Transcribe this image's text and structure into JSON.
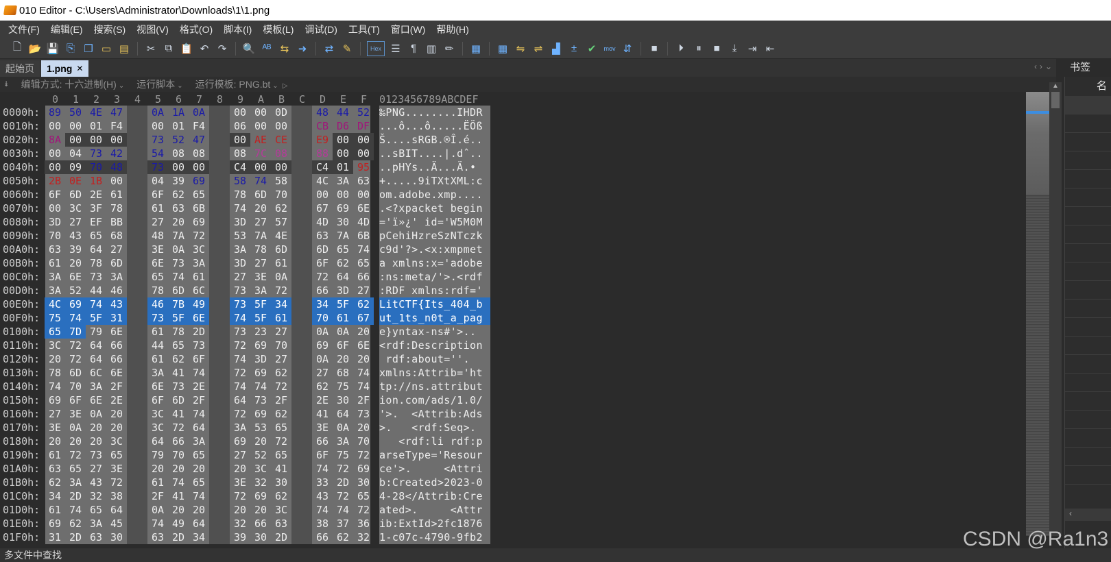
{
  "window": {
    "title": "010 Editor - C:\\Users\\Administrator\\Downloads\\1\\1.png"
  },
  "menu": [
    "文件(F)",
    "编辑(E)",
    "搜索(S)",
    "视图(V)",
    "格式(O)",
    "脚本(I)",
    "模板(L)",
    "调试(D)",
    "工具(T)",
    "窗口(W)",
    "帮助(H)"
  ],
  "tabs": [
    {
      "label": "起始页",
      "active": false
    },
    {
      "label": "1.png",
      "active": true
    }
  ],
  "bookmarks": {
    "title": "书签",
    "column_header": "名"
  },
  "editbar": {
    "edit_mode": "编辑方式: 十六进制(H)",
    "run_script": "运行脚本",
    "run_template": "运行模板: PNG.bt"
  },
  "hex": {
    "col_headers": [
      "0",
      "1",
      "2",
      "3",
      "4",
      "5",
      "6",
      "7",
      "8",
      "9",
      "A",
      "B",
      "C",
      "D",
      "E",
      "F"
    ],
    "ascii_header": "0123456789ABCDEF",
    "rows": [
      {
        "addr": "0000h:",
        "bytes": [
          "89",
          "50",
          "4E",
          "47",
          "0D",
          "0A",
          "1A",
          "0A",
          "00",
          "00",
          "00",
          "0D",
          "49",
          "48",
          "44",
          "52"
        ],
        "ascii": "‰PNG........IHDR"
      },
      {
        "addr": "0010h:",
        "bytes": [
          "00",
          "00",
          "01",
          "F4",
          "00",
          "00",
          "01",
          "F4",
          "08",
          "06",
          "00",
          "00",
          "00",
          "CB",
          "D6",
          "DF"
        ],
        "ascii": "...ô...ô.....ËÖß"
      },
      {
        "addr": "0020h:",
        "bytes": [
          "8A",
          "00",
          "00",
          "00",
          "01",
          "73",
          "52",
          "47",
          "42",
          "00",
          "AE",
          "CE",
          "1C",
          "E9",
          "00",
          "00"
        ],
        "ascii": "Š....sRGB.®Î.é.."
      },
      {
        "addr": "0030h:",
        "bytes": [
          "00",
          "04",
          "73",
          "42",
          "49",
          "54",
          "08",
          "08",
          "08",
          "08",
          "7C",
          "08",
          "64",
          "88",
          "00",
          "00"
        ],
        "ascii": "..sBIT....|.dˆ.."
      },
      {
        "addr": "0040h:",
        "bytes": [
          "00",
          "09",
          "70",
          "48",
          "59",
          "73",
          "00",
          "00",
          "0E",
          "C4",
          "00",
          "00",
          "0E",
          "C4",
          "01",
          "95"
        ],
        "ascii": "..pHYs..Ä...Ä.•"
      },
      {
        "addr": "0050h:",
        "bytes": [
          "2B",
          "0E",
          "1B",
          "00",
          "00",
          "04",
          "39",
          "69",
          "54",
          "58",
          "74",
          "58",
          "4D",
          "4C",
          "3A",
          "63"
        ],
        "ascii": "+.....9iTXtXML:c"
      },
      {
        "addr": "0060h:",
        "bytes": [
          "6F",
          "6D",
          "2E",
          "61",
          "64",
          "6F",
          "62",
          "65",
          "2E",
          "78",
          "6D",
          "70",
          "00",
          "00",
          "00",
          "00"
        ],
        "ascii": "om.adobe.xmp...."
      },
      {
        "addr": "0070h:",
        "bytes": [
          "00",
          "3C",
          "3F",
          "78",
          "70",
          "61",
          "63",
          "6B",
          "65",
          "74",
          "20",
          "62",
          "65",
          "67",
          "69",
          "6E"
        ],
        "ascii": ".<?xpacket begin"
      },
      {
        "addr": "0080h:",
        "bytes": [
          "3D",
          "27",
          "EF",
          "BB",
          "BF",
          "27",
          "20",
          "69",
          "64",
          "3D",
          "27",
          "57",
          "35",
          "4D",
          "30",
          "4D"
        ],
        "ascii": "='ï»¿' id='W5M0M"
      },
      {
        "addr": "0090h:",
        "bytes": [
          "70",
          "43",
          "65",
          "68",
          "69",
          "48",
          "7A",
          "72",
          "65",
          "53",
          "7A",
          "4E",
          "54",
          "63",
          "7A",
          "6B"
        ],
        "ascii": "pCehiHzreSzNTczk"
      },
      {
        "addr": "00A0h:",
        "bytes": [
          "63",
          "39",
          "64",
          "27",
          "3F",
          "3E",
          "0A",
          "3C",
          "78",
          "3A",
          "78",
          "6D",
          "70",
          "6D",
          "65",
          "74"
        ],
        "ascii": "c9d'?>.<x:xmpmet"
      },
      {
        "addr": "00B0h:",
        "bytes": [
          "61",
          "20",
          "78",
          "6D",
          "6C",
          "6E",
          "73",
          "3A",
          "78",
          "3D",
          "27",
          "61",
          "64",
          "6F",
          "62",
          "65"
        ],
        "ascii": "a xmlns:x='adobe"
      },
      {
        "addr": "00C0h:",
        "bytes": [
          "3A",
          "6E",
          "73",
          "3A",
          "6D",
          "65",
          "74",
          "61",
          "2F",
          "27",
          "3E",
          "0A",
          "3C",
          "72",
          "64",
          "66"
        ],
        "ascii": ":ns:meta/'>.<rdf"
      },
      {
        "addr": "00D0h:",
        "bytes": [
          "3A",
          "52",
          "44",
          "46",
          "20",
          "78",
          "6D",
          "6C",
          "6E",
          "73",
          "3A",
          "72",
          "64",
          "66",
          "3D",
          "27"
        ],
        "ascii": ":RDF xmlns:rdf='"
      },
      {
        "addr": "00E0h:",
        "bytes": [
          "4C",
          "69",
          "74",
          "43",
          "54",
          "46",
          "7B",
          "49",
          "74",
          "73",
          "5F",
          "34",
          "30",
          "34",
          "5F",
          "62"
        ],
        "ascii": "LitCTF{Its_404_b"
      },
      {
        "addr": "00F0h:",
        "bytes": [
          "75",
          "74",
          "5F",
          "31",
          "74",
          "73",
          "5F",
          "6E",
          "30",
          "74",
          "5F",
          "61",
          "5F",
          "70",
          "61",
          "67"
        ],
        "ascii": "ut_1ts_n0t_a_pag"
      },
      {
        "addr": "0100h:",
        "bytes": [
          "65",
          "7D",
          "79",
          "6E",
          "74",
          "61",
          "78",
          "2D",
          "6E",
          "73",
          "23",
          "27",
          "3E",
          "0A",
          "0A",
          "20"
        ],
        "ascii": "e}yntax-ns#'>.. "
      },
      {
        "addr": "0110h:",
        "bytes": [
          "3C",
          "72",
          "64",
          "66",
          "3A",
          "44",
          "65",
          "73",
          "63",
          "72",
          "69",
          "70",
          "74",
          "69",
          "6F",
          "6E"
        ],
        "ascii": "<rdf:Description"
      },
      {
        "addr": "0120h:",
        "bytes": [
          "20",
          "72",
          "64",
          "66",
          "3A",
          "61",
          "62",
          "6F",
          "75",
          "74",
          "3D",
          "27",
          "27",
          "0A",
          "20",
          "20"
        ],
        "ascii": " rdf:about=''.  "
      },
      {
        "addr": "0130h:",
        "bytes": [
          "78",
          "6D",
          "6C",
          "6E",
          "73",
          "3A",
          "41",
          "74",
          "74",
          "72",
          "69",
          "62",
          "3D",
          "27",
          "68",
          "74"
        ],
        "ascii": "xmlns:Attrib='ht"
      },
      {
        "addr": "0140h:",
        "bytes": [
          "74",
          "70",
          "3A",
          "2F",
          "2F",
          "6E",
          "73",
          "2E",
          "61",
          "74",
          "74",
          "72",
          "69",
          "62",
          "75",
          "74"
        ],
        "ascii": "tp://ns.attribut"
      },
      {
        "addr": "0150h:",
        "bytes": [
          "69",
          "6F",
          "6E",
          "2E",
          "63",
          "6F",
          "6D",
          "2F",
          "61",
          "64",
          "73",
          "2F",
          "31",
          "2E",
          "30",
          "2F"
        ],
        "ascii": "ion.com/ads/1.0/"
      },
      {
        "addr": "0160h:",
        "bytes": [
          "27",
          "3E",
          "0A",
          "20",
          "20",
          "3C",
          "41",
          "74",
          "74",
          "72",
          "69",
          "62",
          "3A",
          "41",
          "64",
          "73"
        ],
        "ascii": "'>.  <Attrib:Ads"
      },
      {
        "addr": "0170h:",
        "bytes": [
          "3E",
          "0A",
          "20",
          "20",
          "20",
          "3C",
          "72",
          "64",
          "66",
          "3A",
          "53",
          "65",
          "71",
          "3E",
          "0A",
          "20"
        ],
        "ascii": ">.   <rdf:Seq>. "
      },
      {
        "addr": "0180h:",
        "bytes": [
          "20",
          "20",
          "20",
          "3C",
          "72",
          "64",
          "66",
          "3A",
          "6C",
          "69",
          "20",
          "72",
          "64",
          "66",
          "3A",
          "70"
        ],
        "ascii": "   <rdf:li rdf:p"
      },
      {
        "addr": "0190h:",
        "bytes": [
          "61",
          "72",
          "73",
          "65",
          "54",
          "79",
          "70",
          "65",
          "3D",
          "27",
          "52",
          "65",
          "73",
          "6F",
          "75",
          "72"
        ],
        "ascii": "arseType='Resour"
      },
      {
        "addr": "01A0h:",
        "bytes": [
          "63",
          "65",
          "27",
          "3E",
          "0A",
          "20",
          "20",
          "20",
          "20",
          "20",
          "3C",
          "41",
          "74",
          "74",
          "72",
          "69"
        ],
        "ascii": "ce'>.     <Attri"
      },
      {
        "addr": "01B0h:",
        "bytes": [
          "62",
          "3A",
          "43",
          "72",
          "65",
          "61",
          "74",
          "65",
          "64",
          "3E",
          "32",
          "30",
          "32",
          "33",
          "2D",
          "30"
        ],
        "ascii": "b:Created>2023-0"
      },
      {
        "addr": "01C0h:",
        "bytes": [
          "34",
          "2D",
          "32",
          "38",
          "3C",
          "2F",
          "41",
          "74",
          "74",
          "72",
          "69",
          "62",
          "3A",
          "43",
          "72",
          "65"
        ],
        "ascii": "4-28</Attrib:Cre"
      },
      {
        "addr": "01D0h:",
        "bytes": [
          "61",
          "74",
          "65",
          "64",
          "3E",
          "0A",
          "20",
          "20",
          "20",
          "20",
          "20",
          "3C",
          "41",
          "74",
          "74",
          "72"
        ],
        "ascii": "ated>.     <Attr"
      },
      {
        "addr": "01E0h:",
        "bytes": [
          "69",
          "62",
          "3A",
          "45",
          "78",
          "74",
          "49",
          "64",
          "3E",
          "32",
          "66",
          "63",
          "31",
          "38",
          "37",
          "36"
        ],
        "ascii": "ib:ExtId>2fc1876"
      },
      {
        "addr": "01F0h:",
        "bytes": [
          "31",
          "2D",
          "63",
          "30",
          "37",
          "63",
          "2D",
          "34",
          "37",
          "39",
          "30",
          "2D",
          "39",
          "66",
          "62",
          "32"
        ],
        "ascii": "1-c07c-4790-9fb2"
      }
    ]
  },
  "findbar": {
    "label": "多文件中查找"
  },
  "watermark": "CSDN @Ra1n3"
}
